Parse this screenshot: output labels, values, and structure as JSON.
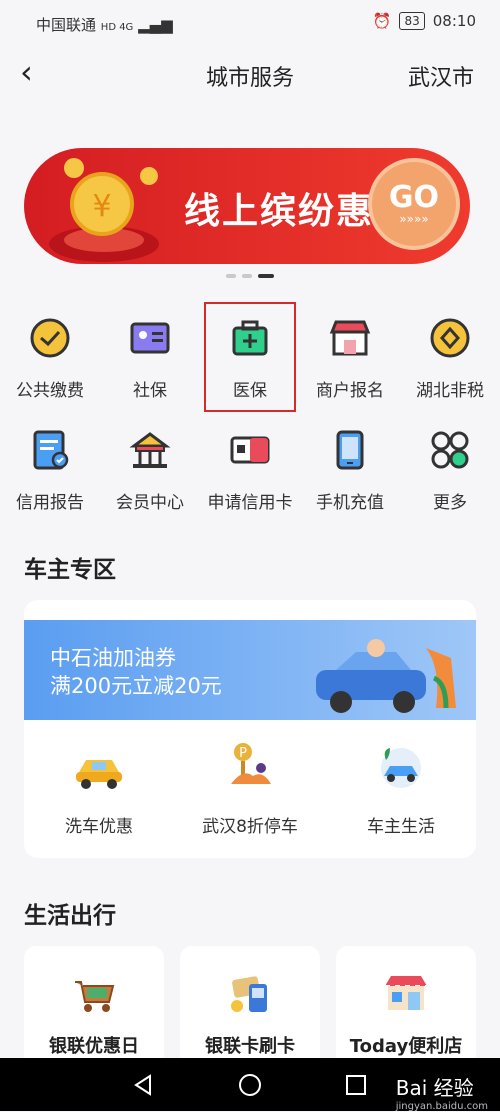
{
  "status": {
    "carrier": "中国联通",
    "network": "HD 4G",
    "battery": "83",
    "time": "08:10"
  },
  "header": {
    "title": "城市服务",
    "city": "武汉市"
  },
  "banner": {
    "text": "线上缤纷惠",
    "go": "GO",
    "go_sub": "»»»»"
  },
  "grid": [
    {
      "label": "公共缴费",
      "icon": "public-payment-icon"
    },
    {
      "label": "社保",
      "icon": "social-security-card-icon"
    },
    {
      "label": "医保",
      "icon": "medical-kit-icon"
    },
    {
      "label": "商户报名",
      "icon": "shop-icon"
    },
    {
      "label": "湖北非税",
      "icon": "diamond-coin-icon"
    },
    {
      "label": "信用报告",
      "icon": "credit-report-icon"
    },
    {
      "label": "会员中心",
      "icon": "member-pavilion-icon"
    },
    {
      "label": "申请信用卡",
      "icon": "credit-card-icon"
    },
    {
      "label": "手机充值",
      "icon": "mobile-phone-icon"
    },
    {
      "label": "更多",
      "icon": "more-grid-icon"
    }
  ],
  "car_section": {
    "title": "车主专区",
    "promo": {
      "line1": "中石油加油券",
      "line2": "满200元立减20元"
    },
    "services": [
      {
        "label": "洗车优惠",
        "icon": "car-wash-icon"
      },
      {
        "label": "武汉8折停车",
        "icon": "parking-icon"
      },
      {
        "label": "车主生活",
        "icon": "car-life-icon"
      }
    ]
  },
  "life_section": {
    "title": "生活出行",
    "tiles": [
      {
        "label": "银联优惠日",
        "icon": "shopping-cart-icon"
      },
      {
        "label": "银联卡刷卡",
        "icon": "card-swipe-icon"
      },
      {
        "label": "Today便利店",
        "icon": "store-icon"
      }
    ]
  },
  "watermark": {
    "text": "Bai 经验",
    "sub": "jingyan.baidu.com"
  },
  "colors": {
    "accent_red": "#d41d22",
    "promo_blue": "#5a9df1",
    "icon_yellow": "#f5c33b",
    "icon_green": "#2fcf8c"
  }
}
